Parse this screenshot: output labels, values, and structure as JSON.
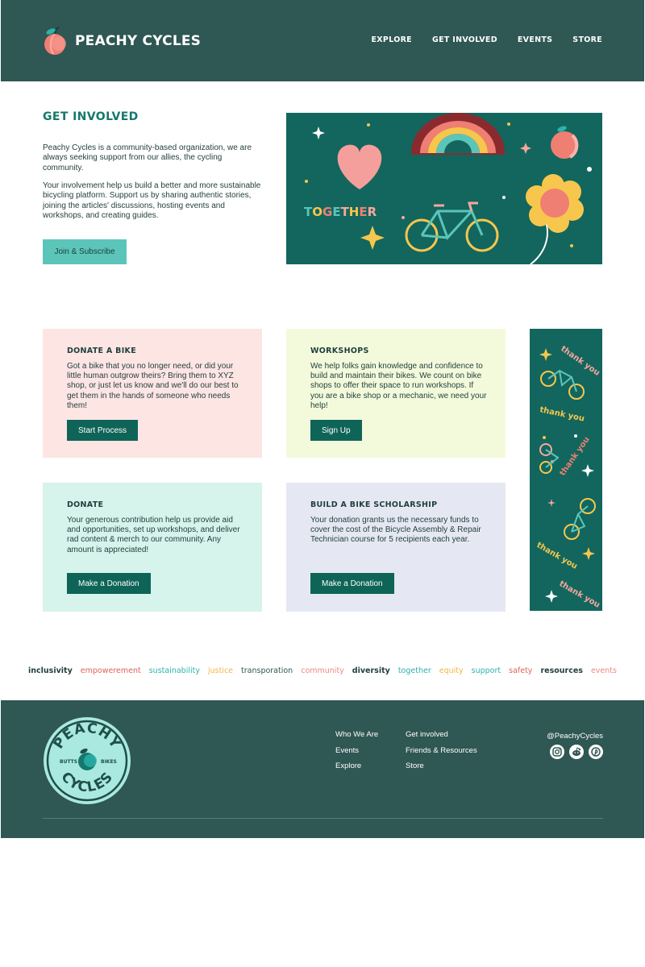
{
  "brand": {
    "name": "PEACHY CYCLES"
  },
  "nav": {
    "explore": "EXPLORE",
    "get_involved": "GET INVOLVED",
    "events": "EVENTS",
    "store": "STORE"
  },
  "hero": {
    "title": "GET INVOLVED",
    "p1": "Peachy Cycles is a community-based organization, we are always seeking support from our allies, the cycling community.",
    "p2": "Your involvement help us build a better and more sustainable bicycling platform. Support us by sharing authentic stories, joining the articles' discussions, hosting events and workshops, and creating guides.",
    "button": "Join & Subscribe",
    "illustration_word": "TOGETHER"
  },
  "cards": [
    {
      "title": "DONATE A BIKE",
      "body": "Got a bike that you no longer need, or did your little human outgrow theirs? Bring them to XYZ shop, or just let us know and we'll do our best to get them in the hands of someone who needs them!",
      "button": "Start Process"
    },
    {
      "title": "WORKSHOPS",
      "body": "We help folks gain knowledge and confidence to build and maintain their bikes. We count on bike shops to offer their space to run workshops. If you are a bike shop or a mechanic, we need your help!",
      "button": "Sign Up"
    },
    {
      "title": "DONATE",
      "body": "Your generous contribution help us provide aid and opportunities, set up workshops, and deliver rad content & merch to our community. Any amount is appreciated!",
      "button": "Make a Donation"
    },
    {
      "title": "BUILD A BIKE SCHOLARSHIP",
      "body": "Your donation grants us the necessary funds to cover the cost of the Bicycle Assembly & Repair Technician course for 5 recipients each year.",
      "button": "Make a Donation"
    }
  ],
  "side_banner": {
    "phrase": "thank you"
  },
  "tags": [
    {
      "label": "inclusivity",
      "color": "#1e3f3b",
      "bold": true
    },
    {
      "label": "empowerement",
      "color": "#e0625a",
      "bold": false
    },
    {
      "label": "sustainability",
      "color": "#2bb3ad",
      "bold": false
    },
    {
      "label": "justice",
      "color": "#f2b544",
      "bold": false
    },
    {
      "label": "transporation",
      "color": "#2f5753",
      "bold": false
    },
    {
      "label": "community",
      "color": "#ef8a80",
      "bold": false
    },
    {
      "label": "diversity",
      "color": "#1e3f3b",
      "bold": true
    },
    {
      "label": "together",
      "color": "#2bb3ad",
      "bold": false
    },
    {
      "label": "equity",
      "color": "#f2b544",
      "bold": false
    },
    {
      "label": "support",
      "color": "#2bb3ad",
      "bold": false
    },
    {
      "label": "safety",
      "color": "#e0625a",
      "bold": false
    },
    {
      "label": "resources",
      "color": "#1e3f3b",
      "bold": true
    },
    {
      "label": "events",
      "color": "#ef8a80",
      "bold": false
    }
  ],
  "footer": {
    "badge_top": "PEACHY",
    "badge_bottom": "CYCLES",
    "badge_left": "BUTTS",
    "badge_right": "BIKES",
    "col1": [
      "Who We Are",
      "Events",
      "Explore"
    ],
    "col2": [
      "Get involved",
      "Friends & Resources",
      "Store"
    ],
    "handle": "@PeachyCycles",
    "socials": [
      "instagram-icon",
      "reddit-icon",
      "pinterest-icon"
    ]
  },
  "colors": {
    "header_bg": "#2f5753",
    "accent_teal": "#16776d",
    "button_teal": "#0f6458",
    "join_button": "#5cc5ba",
    "peach": "#ef7f73"
  }
}
